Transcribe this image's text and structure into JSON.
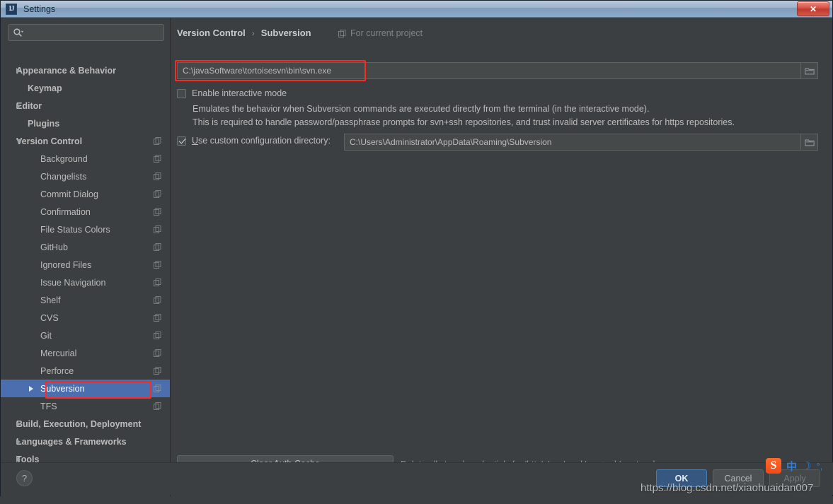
{
  "window": {
    "title": "Settings",
    "app_icon": "intellij-idea-icon",
    "close_label": "✕"
  },
  "search": {
    "value": "",
    "placeholder": ""
  },
  "sidebar": {
    "items": [
      {
        "label": "Appearance & Behavior",
        "level": "top",
        "arrow": "closed",
        "project_icon": false,
        "selected": false
      },
      {
        "label": "Keymap",
        "level": "top",
        "arrow": "none",
        "project_icon": false,
        "selected": false
      },
      {
        "label": "Editor",
        "level": "top",
        "arrow": "closed",
        "project_icon": false,
        "selected": false
      },
      {
        "label": "Plugins",
        "level": "top",
        "arrow": "none",
        "project_icon": false,
        "selected": false
      },
      {
        "label": "Version Control",
        "level": "top",
        "arrow": "open",
        "project_icon": true,
        "selected": false
      },
      {
        "label": "Background",
        "level": "child",
        "arrow": "none",
        "project_icon": true,
        "selected": false
      },
      {
        "label": "Changelists",
        "level": "child",
        "arrow": "none",
        "project_icon": true,
        "selected": false
      },
      {
        "label": "Commit Dialog",
        "level": "child",
        "arrow": "none",
        "project_icon": true,
        "selected": false
      },
      {
        "label": "Confirmation",
        "level": "child",
        "arrow": "none",
        "project_icon": true,
        "selected": false
      },
      {
        "label": "File Status Colors",
        "level": "child",
        "arrow": "none",
        "project_icon": true,
        "selected": false
      },
      {
        "label": "GitHub",
        "level": "child",
        "arrow": "none",
        "project_icon": true,
        "selected": false
      },
      {
        "label": "Ignored Files",
        "level": "child",
        "arrow": "none",
        "project_icon": true,
        "selected": false
      },
      {
        "label": "Issue Navigation",
        "level": "child",
        "arrow": "none",
        "project_icon": true,
        "selected": false
      },
      {
        "label": "Shelf",
        "level": "child",
        "arrow": "none",
        "project_icon": true,
        "selected": false
      },
      {
        "label": "CVS",
        "level": "child",
        "arrow": "none",
        "project_icon": true,
        "selected": false
      },
      {
        "label": "Git",
        "level": "child",
        "arrow": "none",
        "project_icon": true,
        "selected": false
      },
      {
        "label": "Mercurial",
        "level": "child",
        "arrow": "none",
        "project_icon": true,
        "selected": false
      },
      {
        "label": "Perforce",
        "level": "child",
        "arrow": "none",
        "project_icon": true,
        "selected": false
      },
      {
        "label": "Subversion",
        "level": "child",
        "arrow": "closed",
        "project_icon": true,
        "selected": true
      },
      {
        "label": "TFS",
        "level": "child",
        "arrow": "none",
        "project_icon": true,
        "selected": false
      },
      {
        "label": "Build, Execution, Deployment",
        "level": "top",
        "arrow": "closed",
        "project_icon": false,
        "selected": false
      },
      {
        "label": "Languages & Frameworks",
        "level": "top",
        "arrow": "closed",
        "project_icon": false,
        "selected": false
      },
      {
        "label": "Tools",
        "level": "top",
        "arrow": "closed",
        "project_icon": false,
        "selected": false
      }
    ]
  },
  "breadcrumb": {
    "root": "Version Control",
    "separator": "›",
    "leaf": "Subversion",
    "scope": "For current project"
  },
  "main": {
    "svn_path_value": "C:\\javaSoftware\\tortoisesvn\\bin\\svn.exe",
    "interactive_mode_label": "Enable interactive mode",
    "interactive_mode_checked": false,
    "description_line1": "Emulates the behavior when Subversion commands are executed directly from the terminal (in the interactive mode).",
    "description_line2": "This is required to handle password/passphrase prompts for svn+ssh repositories, and trust invalid server certificates for https repositories.",
    "config_dir_label_pre": "U",
    "config_dir_label_post": "se custom configuration directory:",
    "config_dir_checked": true,
    "config_dir_value": "C:\\Users\\Administrator\\AppData\\Roaming\\Subversion",
    "clear_auth_pre": "C",
    "clear_auth_post": "lear Auth Cache",
    "clear_auth_note": "Delete all stored credentials for 'http', 'svn' and 'svn+ssh' protocols"
  },
  "footer": {
    "help_label": "?",
    "ok_label": "OK",
    "cancel_label": "Cancel",
    "apply_label": "Apply"
  },
  "overlays": {
    "watermark": "https://blog.csdn.net/xiaohuaidan007",
    "ime_logo": "S",
    "ime_mode": "中",
    "ime_moon": "☽",
    "ime_punct": "°,"
  },
  "colors": {
    "panel_bg": "#3c3f41",
    "selection_blue": "#4b6eaf",
    "annotation_red": "#ff2a1f",
    "primary_button": "#365880",
    "text": "#bbbbbb"
  }
}
